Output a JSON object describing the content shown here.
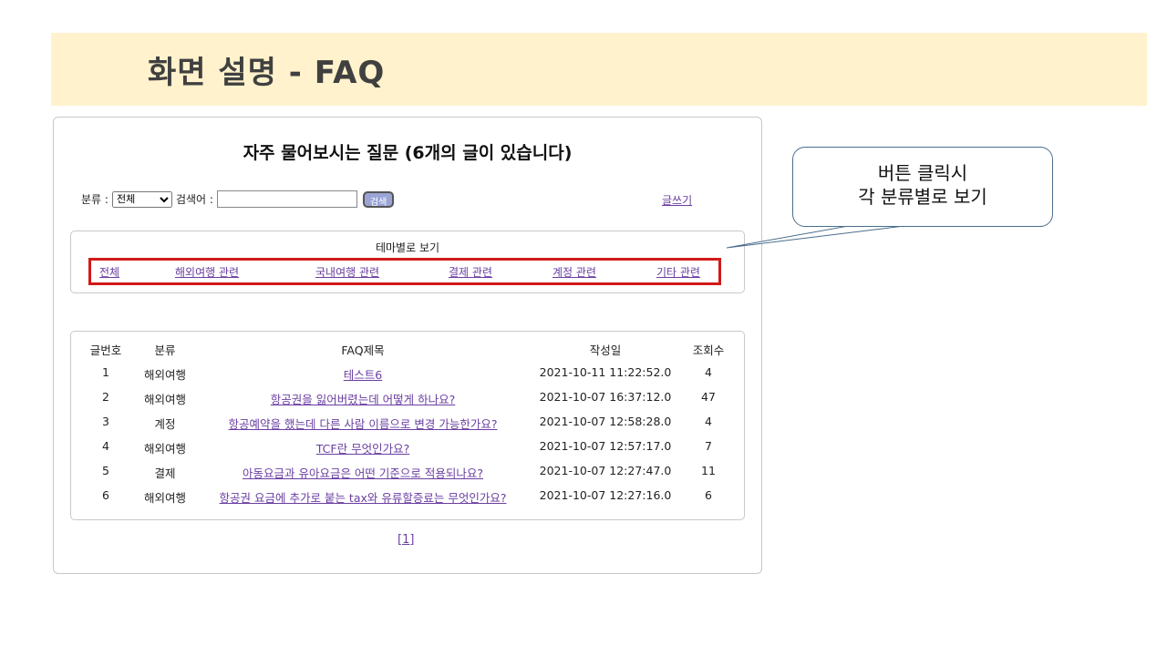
{
  "slide": {
    "title": "화면 설명 - FAQ"
  },
  "faq": {
    "heading": "자주 물어보시는 질문 (6개의 글이 있습니다)",
    "search": {
      "category_label": "분류 :",
      "category_selected": "전체",
      "keyword_label": "검색어 :",
      "keyword_value": "",
      "button_label": "검색"
    },
    "write_link": "글쓰기",
    "theme": {
      "heading": "테마별로 보기",
      "links": [
        "전체",
        "해외여행 관련",
        "국내여행 관련",
        "결제 관련",
        "계정 관련",
        "기타 관련"
      ]
    },
    "table": {
      "headers": [
        "글번호",
        "분류",
        "FAQ제목",
        "작성일",
        "조회수"
      ],
      "rows": [
        [
          "1",
          "해외여행",
          "테스트6",
          "2021-10-11 11:22:52.0",
          "4"
        ],
        [
          "2",
          "해외여행",
          "항공권을 잃어버렸는데 어떻게 하나요?",
          "2021-10-07 16:37:12.0",
          "47"
        ],
        [
          "3",
          "계정",
          "항공예약을 했는데 다른 사람 이름으로 변경 가능한가요?",
          "2021-10-07 12:58:28.0",
          "4"
        ],
        [
          "4",
          "해외여행",
          "TCF란 무엇인가요?",
          "2021-10-07 12:57:17.0",
          "7"
        ],
        [
          "5",
          "결제",
          "아동요금과 유아요금은 어떤 기준으로 적용되나요?",
          "2021-10-07 12:27:47.0",
          "11"
        ],
        [
          "6",
          "해외여행",
          "항공권 요금에 추가로 붙는 tax와 유류할증료는 무엇인가요?",
          "2021-10-07 12:27:16.0",
          "6"
        ]
      ]
    },
    "pager": "[1]"
  },
  "callout": {
    "line1": "버튼 클릭시",
    "line2": "각 분류별로 보기"
  },
  "colors": {
    "banner": "#fff2cc",
    "link": "#6a3ea1",
    "highlight_border": "#d11a1a",
    "callout_border": "#4a6d8c"
  }
}
